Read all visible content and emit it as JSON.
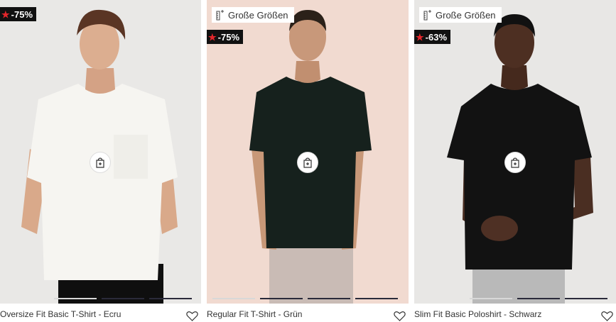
{
  "products": [
    {
      "title": "Oversize Fit Basic T-Shirt - Ecru",
      "discount": "-75%",
      "size_badge": "",
      "bg_color": "#e7e6e4",
      "shirt_color": "#f6f5f1"
    },
    {
      "title": "Regular Fit T-Shirt - Grün",
      "discount": "-75%",
      "size_badge": "Große Größen",
      "bg_color": "#f0d9cf",
      "shirt_color": "#16211d"
    },
    {
      "title": "Slim Fit Basic Poloshirt - Schwarz",
      "discount": "-63%",
      "size_badge": "Große Größen",
      "bg_color": "#e7e6e4",
      "shirt_color": "#121212"
    }
  ],
  "icons": {
    "discount": "star-icon",
    "size": "ruler-plus-icon",
    "cart": "shopping-bag-plus-icon",
    "favorite": "heart-outline-icon"
  }
}
